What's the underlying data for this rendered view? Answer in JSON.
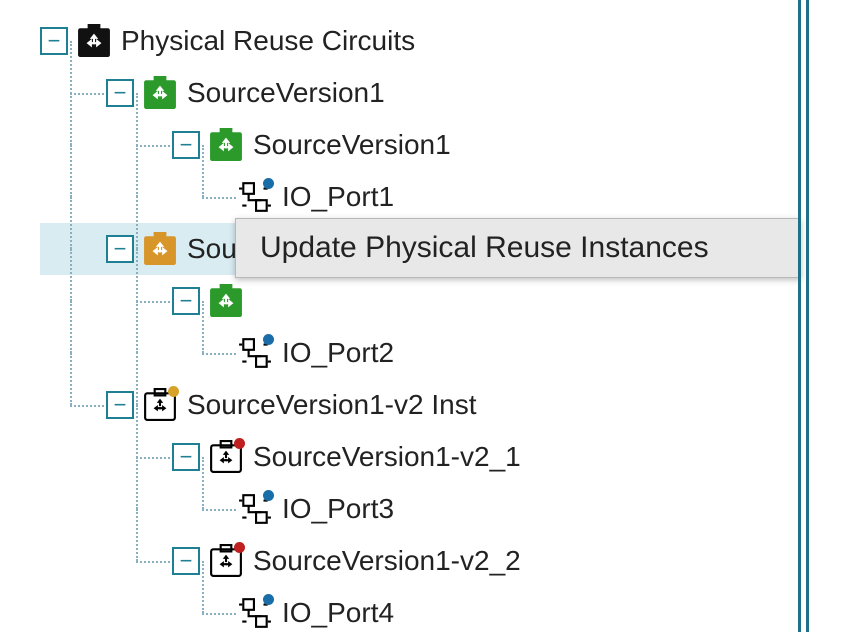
{
  "tree": {
    "root": {
      "label": "Physical Reuse Circuits"
    },
    "n1": {
      "label": "SourceVersion1"
    },
    "n1_1": {
      "label": "SourceVersion1"
    },
    "n1_1_port": {
      "label": "IO_Port1"
    },
    "n2_partial": {
      "label": "Sou"
    },
    "n2_1_port": {
      "label": "IO_Port2"
    },
    "n3": {
      "label": "SourceVersion1-v2 Inst"
    },
    "n3_1": {
      "label": "SourceVersion1-v2_1"
    },
    "n3_1_port": {
      "label": "IO_Port3"
    },
    "n3_2": {
      "label": "SourceVersion1-v2_2"
    },
    "n3_2_port": {
      "label": "IO_Port4"
    }
  },
  "context_menu": {
    "item1": "Update Physical Reuse Instances"
  },
  "icons": {
    "recycle_black": "recycle-icon-black",
    "recycle_green": "recycle-icon-green",
    "recycle_orange": "recycle-icon-orange",
    "schematic": "schematic-icon",
    "port": "port-icon"
  },
  "colors": {
    "badge_blue": "#1a6da8",
    "badge_orange": "#d8a12a",
    "badge_red": "#c01f1f"
  }
}
